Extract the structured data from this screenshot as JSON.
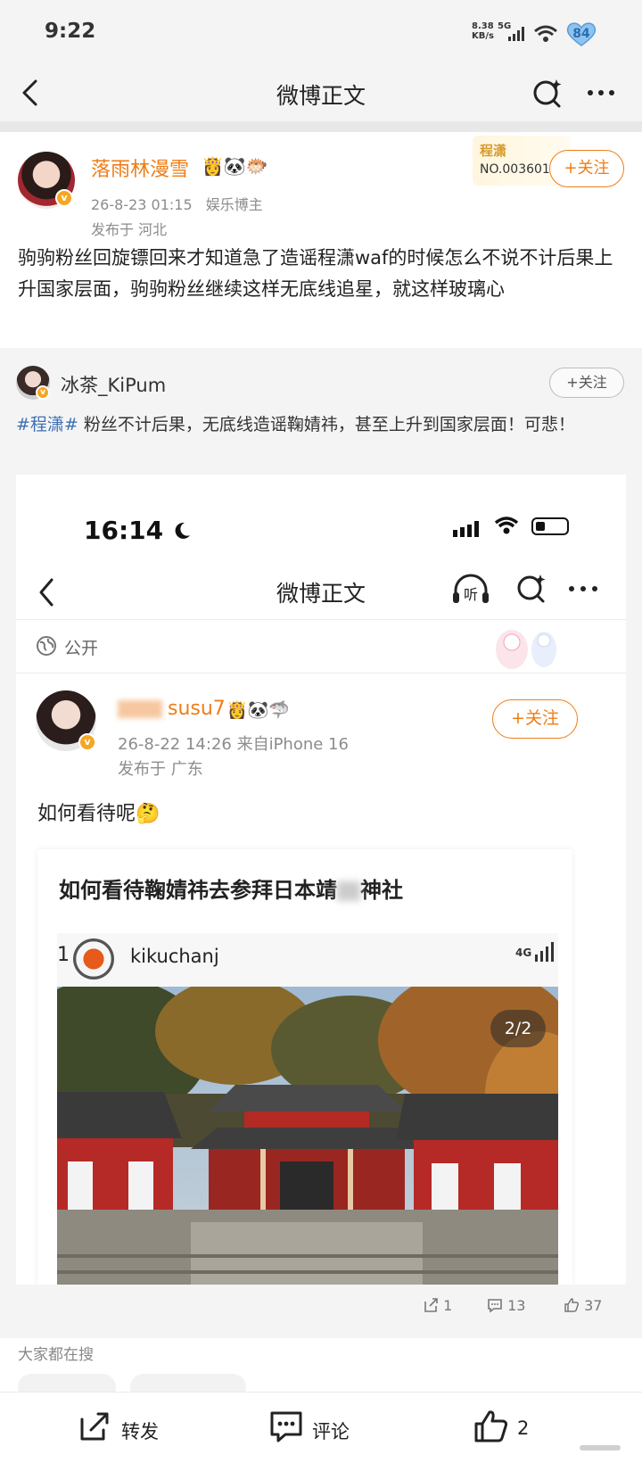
{
  "status_bar": {
    "time": "9:22",
    "speed_value": "8.38",
    "speed_unit": "KB/s",
    "network": "5G",
    "battery": "84"
  },
  "nav": {
    "title": "微博正文"
  },
  "post": {
    "author": "落雨林漫雪",
    "emojis": "👸🐼🐡",
    "date": "26-8-23 01:15",
    "tag": "娱乐博主",
    "location": "发布于 河北",
    "badge_name": "程潇",
    "badge_no": "NO.003601",
    "follow_label": "+关注",
    "text": "驹驹粉丝回旋镖回来才知道急了造谣程潇waf的时候怎么不说不计后果上升国家层面，驹驹粉丝继续这样无底线追星，就这样玻璃心"
  },
  "repost": {
    "author": "冰茶_KiPum",
    "follow_label": "+关注",
    "hashtag": "#程潇#",
    "text": " 粉丝不计后果，无底线造谣鞠婧祎，甚至上升到国家层面！可悲！",
    "screenshot": {
      "time": "16:14",
      "title": "微博正文",
      "listen_label": "听",
      "visibility": "公开",
      "author_suffix": "susu7",
      "emojis": "👸🐼🦈",
      "date_device": "26-8-22 14:26  来自iPhone 16",
      "location": "发布于 广东",
      "follow_label": "+关注",
      "text": "如何看待呢🤔",
      "card_title": "如何看待鞠婧祎去参拜日本靖",
      "card_title_end": "神社",
      "card_num": "1",
      "card_user": "kikuchanj",
      "card_network": "4G",
      "page_indicator": "2/2"
    },
    "stats": {
      "reposts": "1",
      "comments": "13",
      "likes": "37"
    }
  },
  "search_section": {
    "label": "大家都在搜"
  },
  "bottom_bar": {
    "repost": "转发",
    "comment": "评论",
    "like_count": "2"
  },
  "colors": {
    "accent": "#ef7d17",
    "link": "#3d6fb5"
  }
}
